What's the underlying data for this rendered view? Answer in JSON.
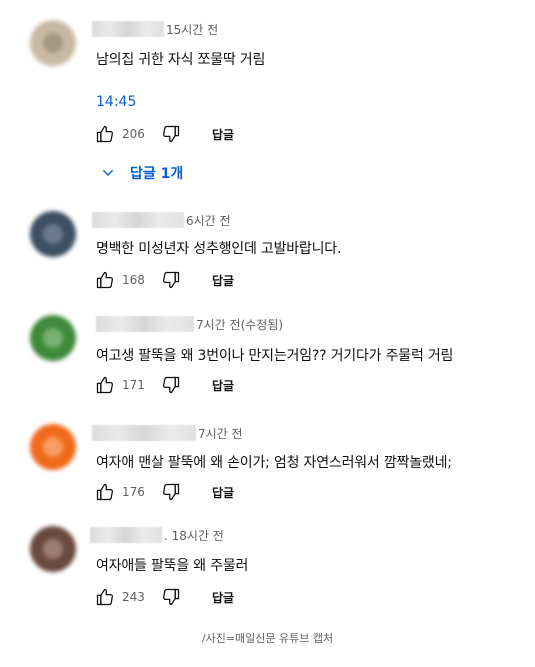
{
  "comments": [
    {
      "time": "15시간 전",
      "text": "남의집 귀한 자식 쪼물딱 거림",
      "timestamp_link": "14:45",
      "likes": "206",
      "reply_label": "답글",
      "replies_toggle": "답글 1개",
      "avatar_color": "#c9b9a3"
    },
    {
      "time": "6시간 전",
      "text": "명백한 미성년자 성추행인데 고발바랍니다.",
      "likes": "168",
      "reply_label": "답글",
      "avatar_color": "#3d4f63"
    },
    {
      "time": "7시간 전(수정됨)",
      "text": "여고생 팔뚝을 왜 3번이나  만지는거임?? 거기다가 주물럭 거림",
      "likes": "171",
      "reply_label": "답글",
      "avatar_color": "#3f8a3a"
    },
    {
      "time": "7시간 전",
      "text": "여자애 맨살 팔뚝에 왜 손이가; 엄청 자연스러워서 깜짝놀랬네;",
      "likes": "176",
      "reply_label": "답글",
      "avatar_color": "#f06a1c"
    },
    {
      "time": ". 18시간 전",
      "text": "여자애들 팔뚝을 왜 주물러",
      "likes": "243",
      "reply_label": "답글",
      "avatar_color": "#6b4a3f"
    }
  ],
  "caption": "/사진=매일신문 유튜브 캡처",
  "icons": {
    "like": "thumbs-up-icon",
    "dislike": "thumbs-down-icon",
    "expand": "chevron-down-icon"
  },
  "colors": {
    "link": "#065fd4",
    "secondary_text": "#606060"
  }
}
